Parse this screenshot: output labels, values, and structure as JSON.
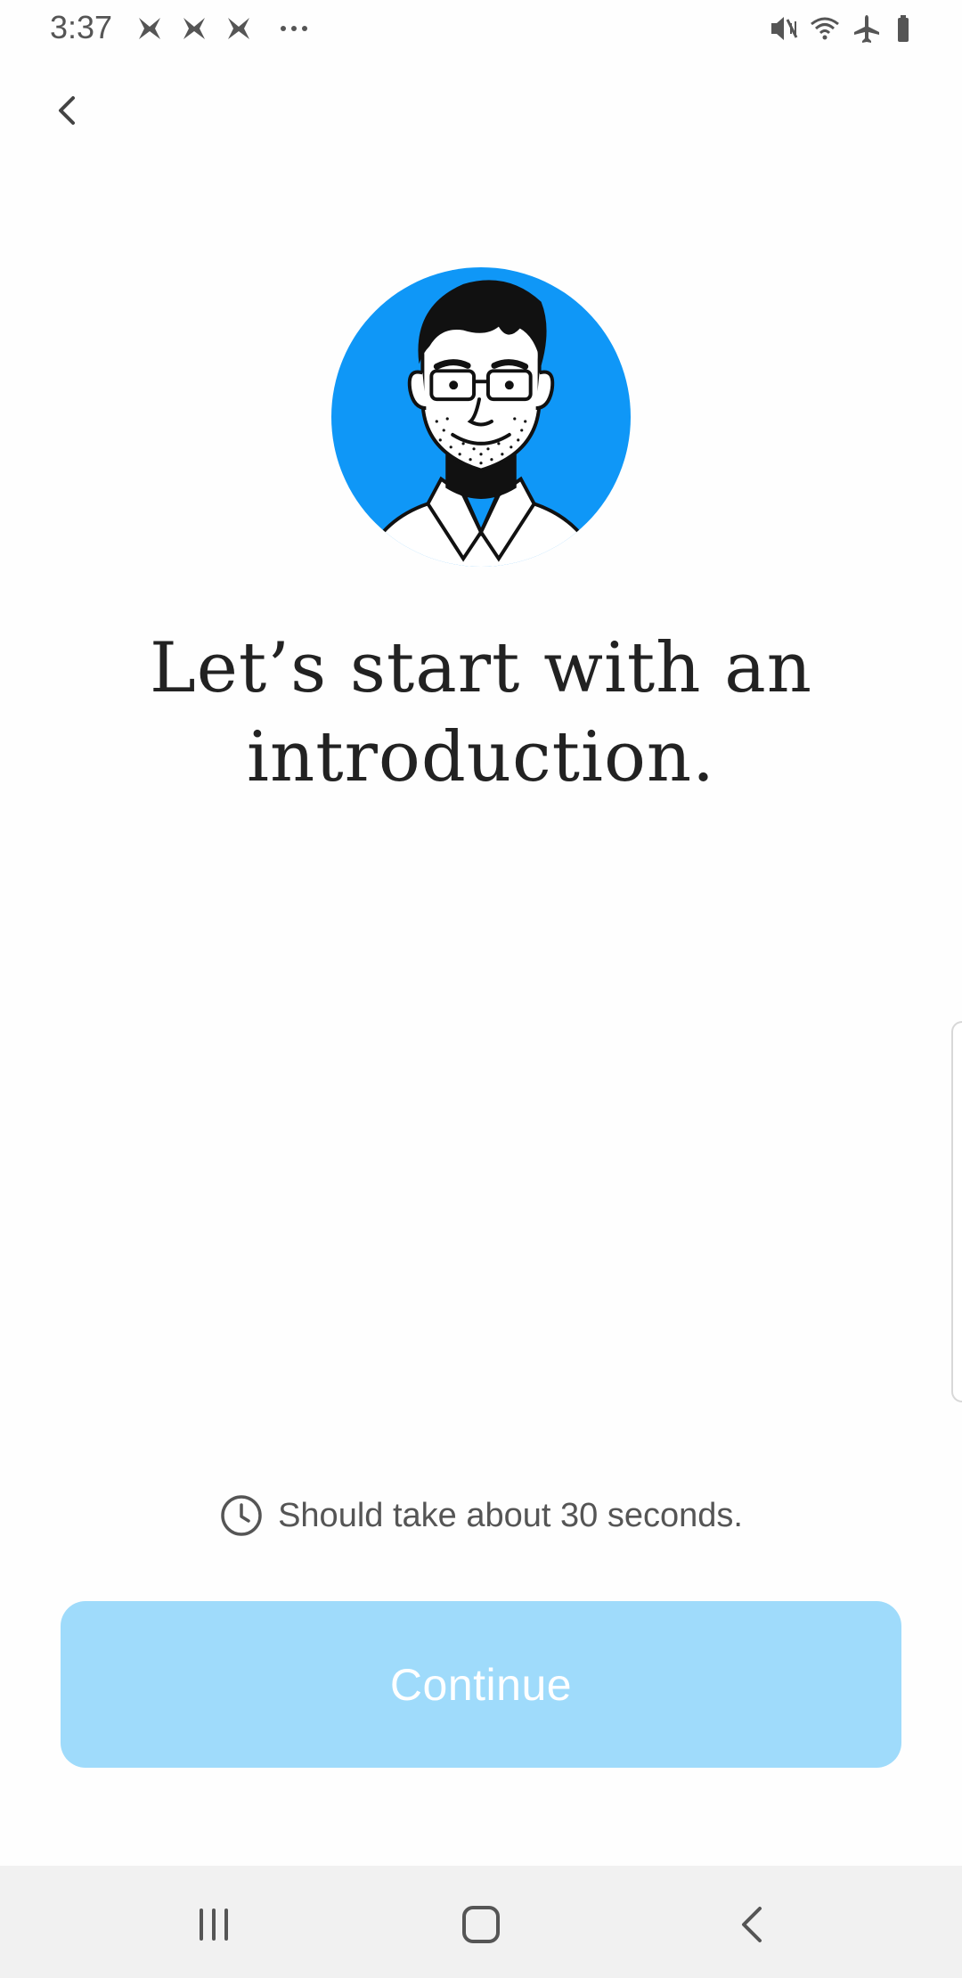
{
  "status_bar": {
    "time": "3:37",
    "left_icons": [
      "x-notification-icon",
      "x-notification-icon",
      "x-notification-icon",
      "more-dots-icon"
    ],
    "right_icons": [
      "vibrate-mute-icon",
      "wifi-icon",
      "airplane-mode-icon",
      "battery-icon"
    ]
  },
  "header": {
    "back_icon": "chevron-left-icon"
  },
  "main": {
    "avatar_icon": "illustrated-man-with-glasses-avatar",
    "avatar_bg_color": "#0f97f7",
    "heading_line1": "Let’s start with an",
    "heading_line2": "introduction."
  },
  "footer": {
    "time_hint": "Should take about 30 seconds.",
    "clock_icon": "clock-icon",
    "continue_label": "Continue",
    "continue_color": "#9fdbfb"
  },
  "nav_bar": {
    "items": [
      "recent-apps-icon",
      "home-icon",
      "back-icon"
    ]
  }
}
